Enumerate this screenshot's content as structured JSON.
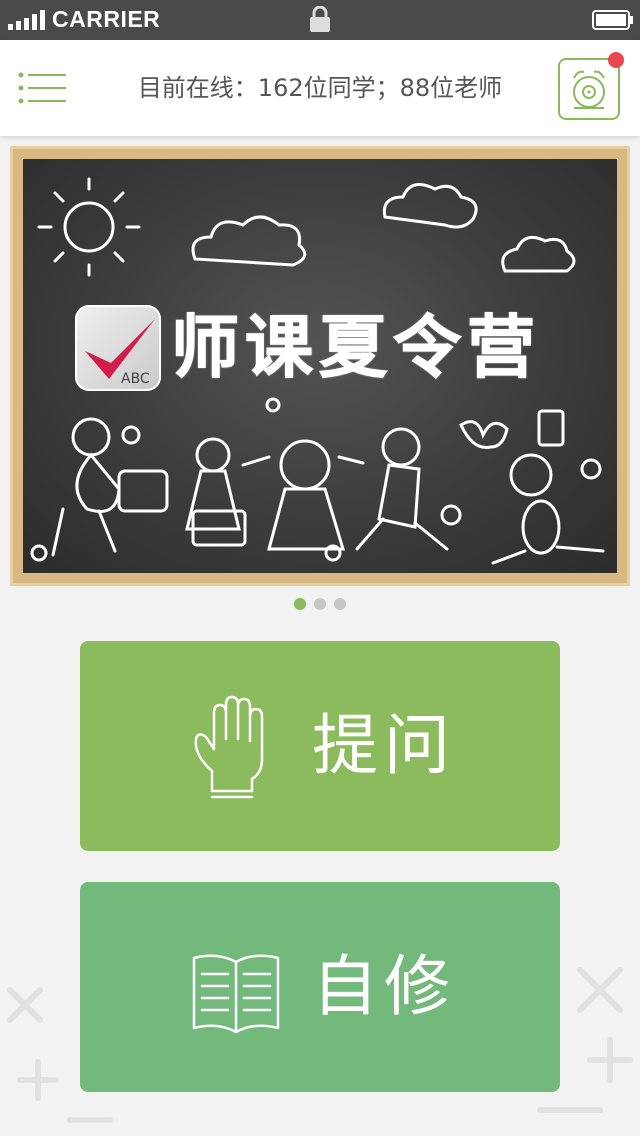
{
  "status_bar": {
    "carrier": "CARRIER"
  },
  "header": {
    "online_text": "目前在线：162位同学；88位老师",
    "menu_icon": "menu-lines-icon",
    "alarm_icon": "alarm-clock-icon",
    "notification_color": "#e8484d"
  },
  "banner": {
    "title": "师课夏令营",
    "logo_text": "ABC",
    "slides": 3,
    "active_slide": 1
  },
  "actions": {
    "ask": {
      "label": "提问",
      "icon": "hand-icon",
      "color": "#8bbb5d"
    },
    "study": {
      "label": "自修",
      "icon": "book-icon",
      "color": "#73b97b"
    }
  },
  "colors": {
    "accent": "#8ab95a",
    "status_bar": "#4a4a4a"
  }
}
